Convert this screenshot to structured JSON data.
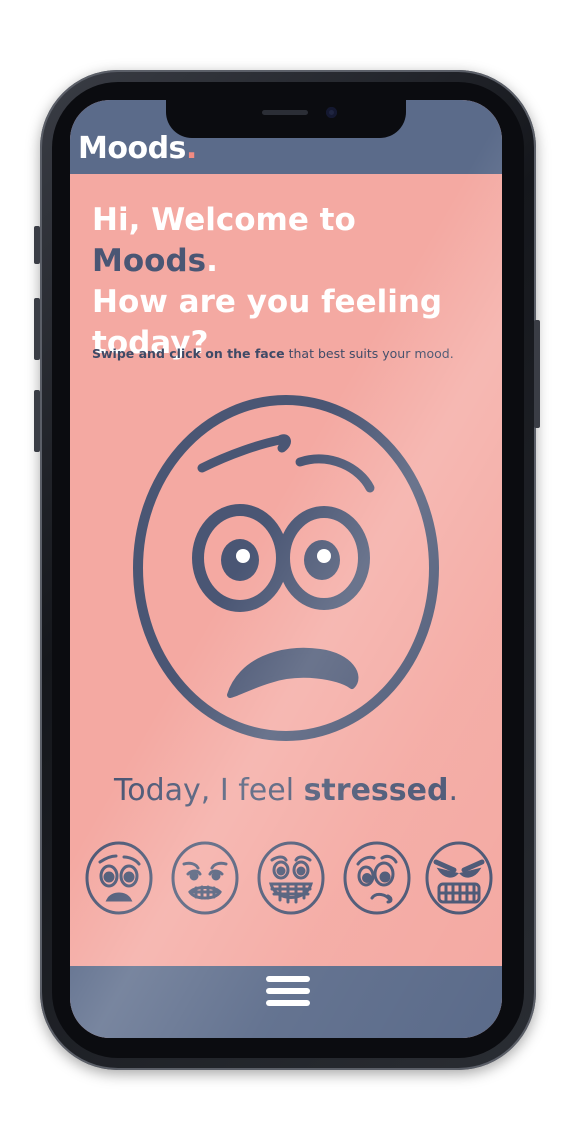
{
  "app": {
    "logo_text": "Moods",
    "logo_dot": "."
  },
  "welcome": {
    "line1_prefix": "Hi, Welcome to ",
    "brand": "Moods",
    "line1_suffix": ".",
    "line2": "How are you feeling",
    "line3": "today?"
  },
  "instruction": {
    "bold_part": "Swipe and click on the face",
    "rest": " that best suits your mood."
  },
  "feeling": {
    "prefix": "Today, I feel ",
    "mood": "stressed",
    "suffix": "."
  },
  "mood_options": [
    {
      "name": "worried",
      "icon": "worried-face-icon"
    },
    {
      "name": "anxious",
      "icon": "anxious-face-icon"
    },
    {
      "name": "excited",
      "icon": "grinning-face-icon"
    },
    {
      "name": "confused",
      "icon": "confused-face-icon"
    },
    {
      "name": "angry",
      "icon": "angry-face-icon"
    }
  ],
  "colors": {
    "screen_bg": "#f4a9a2",
    "header_bg": "#5b6b8a",
    "ink": "#4a5674",
    "accent": "#f28b82",
    "white": "#ffffff"
  },
  "icons": {
    "menu": "hamburger-menu-icon",
    "selected_face": "stressed-face-icon"
  }
}
